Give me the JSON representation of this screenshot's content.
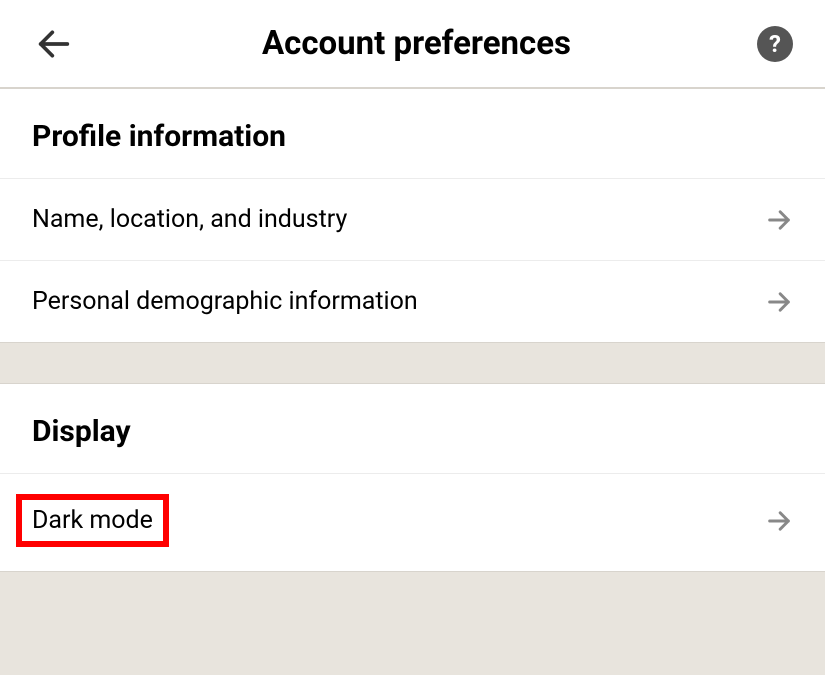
{
  "header": {
    "title": "Account preferences"
  },
  "sections": {
    "profile": {
      "title": "Profile information",
      "rows": {
        "name_location_industry": "Name, location, and industry",
        "personal_demographic": "Personal demographic information"
      }
    },
    "display": {
      "title": "Display",
      "rows": {
        "dark_mode": "Dark mode"
      }
    }
  }
}
